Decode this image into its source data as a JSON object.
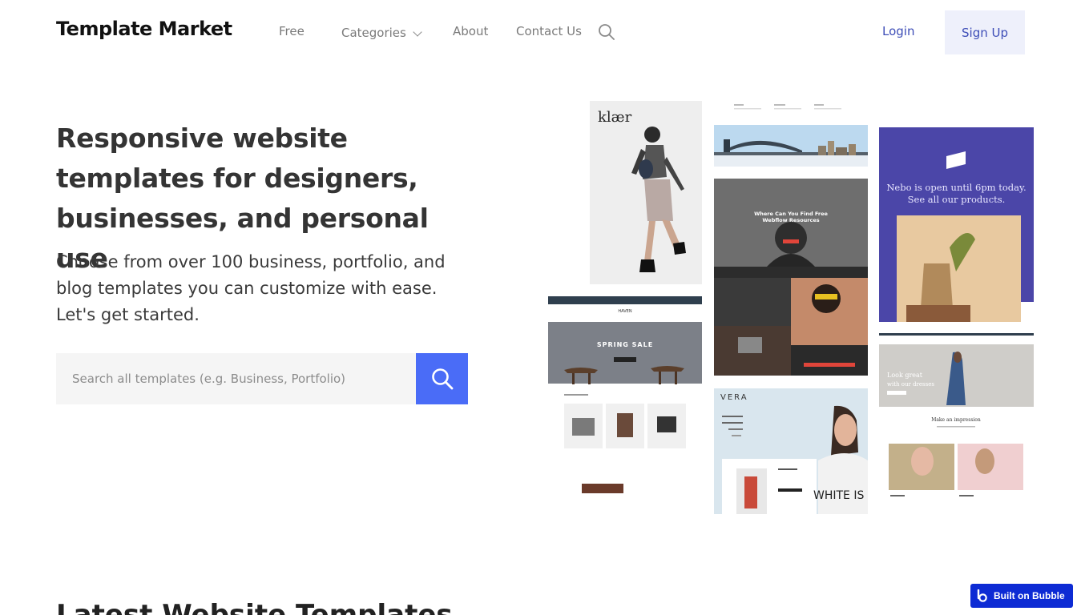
{
  "header": {
    "logo": "Template Market",
    "nav": {
      "free": "Free",
      "categories": "Categories",
      "about": "About",
      "contact": "Contact Us"
    },
    "login": "Login",
    "signup": "Sign Up"
  },
  "hero": {
    "title": "Responsive website templates for designers, businesses, and personal use",
    "subtitle": "Choose from over 100 business, portfolio, and blog templates you can customize with ease. Let's get started.",
    "search_placeholder": "Search all templates (e.g. Business, Portfolio)"
  },
  "thumbnails": {
    "klaer_brand": "klær",
    "vera_brand": "VERA",
    "nebo_message_line1": "Nebo is open until 6pm today.",
    "nebo_message_line2": "See all our products.",
    "haven_banner": "SPRING SALE",
    "webflow_heading": "Where Can You Find Free Webflow Resources",
    "vera_banner": "WHITE IS E",
    "look_great": "Look great with our dresses"
  },
  "section": {
    "latest_title": "Latest Website Templates"
  },
  "badge": {
    "label": "Built on Bubble"
  },
  "colors": {
    "accent": "#4a6cf7",
    "link": "#3d4db7",
    "signup_bg": "#eef0fb",
    "nebo_bg": "#4b46a8",
    "badge_bg": "#0d2bd4"
  },
  "icons": {
    "nav_search": "search-icon",
    "search_button": "search-icon",
    "categories_caret": "chevron-down-icon",
    "badge": "bubble-logo-icon"
  }
}
